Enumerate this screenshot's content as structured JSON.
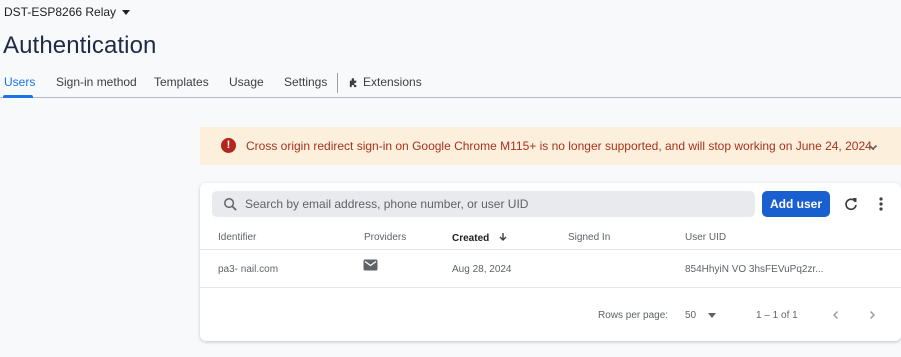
{
  "project": {
    "name": "DST-ESP8266 Relay"
  },
  "page": {
    "title": "Authentication"
  },
  "tabs": [
    {
      "label": "Users"
    },
    {
      "label": "Sign-in method"
    },
    {
      "label": "Templates"
    },
    {
      "label": "Usage"
    },
    {
      "label": "Settings"
    },
    {
      "label": "Extensions"
    }
  ],
  "banner": {
    "text": "Cross origin redirect sign-in on Google Chrome M115+ is no longer supported, and will stop working on June 24, 2024.",
    "icon": "error-icon",
    "color": "#b3261e"
  },
  "search": {
    "placeholder": "Search by email address, phone number, or user UID"
  },
  "toolbar": {
    "add_label": "Add user"
  },
  "table": {
    "columns": [
      "Identifier",
      "Providers",
      "Created",
      "Signed In",
      "User UID"
    ],
    "sorted_column": "Created",
    "rows": [
      {
        "identifier": "pa3-              nail.com",
        "provider_icon": "email-icon",
        "created": "Aug 28, 2024",
        "signed_in": "",
        "uid": "854HhyiN   VO   3hsFEVuPq2zr..."
      }
    ]
  },
  "pagination": {
    "rows_label": "Rows per page:",
    "rows_value": "50",
    "range": "1 – 1 of 1"
  },
  "colors": {
    "accent": "#1a73e8",
    "button": "#1a5fd0",
    "banner_bg": "#fcefdc",
    "banner_text": "#a8321e"
  }
}
